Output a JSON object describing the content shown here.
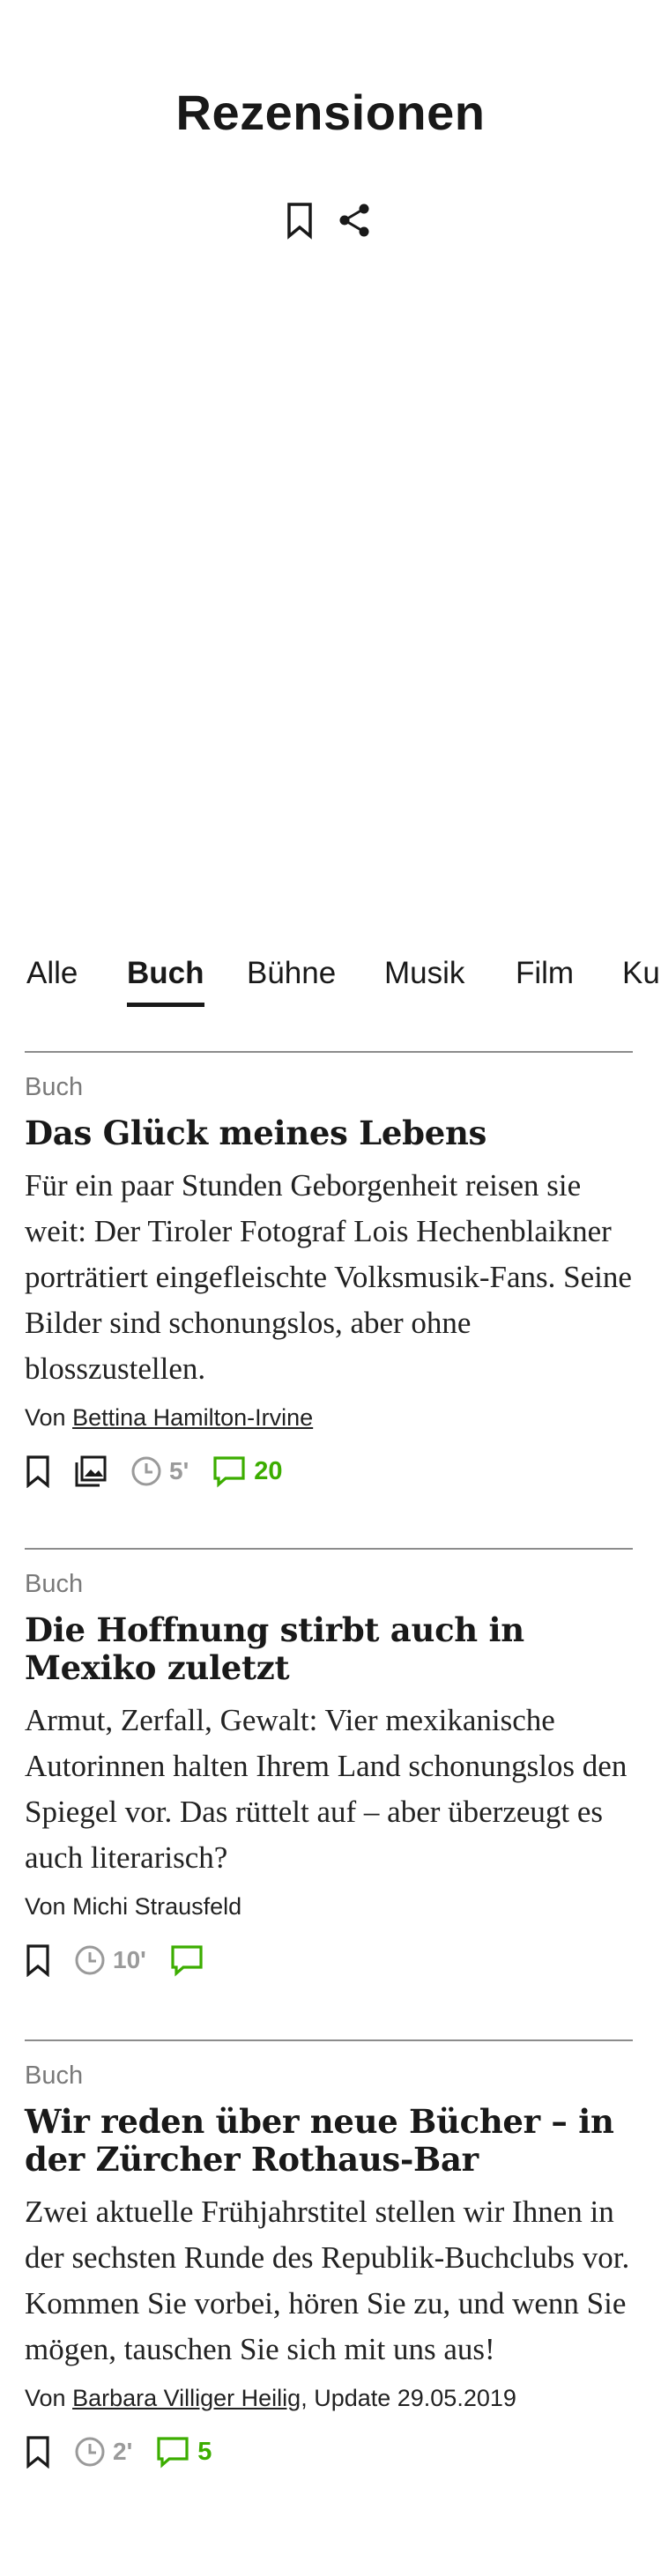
{
  "header": {
    "title": "Rezensionen"
  },
  "tabs": [
    {
      "label": "Alle"
    },
    {
      "label": "Buch"
    },
    {
      "label": "Bühne"
    },
    {
      "label": "Musik"
    },
    {
      "label": "Film"
    },
    {
      "label": "Ku"
    }
  ],
  "active_tab": "Buch",
  "articles": [
    {
      "category": "Buch",
      "title": "Das Glück meines Lebens",
      "lead": "Für ein paar Stunden Geborgenheit reisen sie weit: Der Tiroler Fotograf Lois Hechenblaikner porträtiert eingefleischte Volksmusik-Fans. Seine Bilder sind schonungslos, aber ohne blosszustellen.",
      "byline_prefix": "Von ",
      "author": "Bettina Hamilton-Irvine",
      "byline_suffix": "",
      "reading_time": "5'",
      "comments": "20"
    },
    {
      "category": "Buch",
      "title": "Die Hoffnung stirbt auch in Mexiko zuletzt",
      "lead": "Armut, Zerfall, Gewalt: Vier mexikanische Autorinnen halten Ihrem Land schonungslos den Spiegel vor. Das rüttelt auf – aber überzeugt es auch literarisch?",
      "byline_prefix": "Von ",
      "author": "Michi Strausfeld",
      "byline_suffix": "",
      "reading_time": "10'",
      "comments": ""
    },
    {
      "category": "Buch",
      "title": "Wir reden über neue Bücher – in der Zürcher Rothaus-Bar",
      "lead": "Zwei aktuelle Frühjahrstitel stellen wir Ihnen in der sechsten Runde des Republik-Buchclubs vor. Kommen Sie vorbei, hören Sie zu, und wenn Sie mögen, tauschen Sie sich mit uns aus!",
      "byline_prefix": "Von ",
      "author": "Barbara Villiger Heilig",
      "byline_suffix": ", Update 29.05.2019",
      "reading_time": "2'",
      "comments": "5"
    }
  ],
  "colors": {
    "text": "#191919",
    "muted": "#7a7a7a",
    "comment_accent": "#3cad00",
    "divider": "#8c8c8c"
  },
  "icons": {
    "header": [
      "bookmark-icon",
      "share-icon"
    ],
    "meta": [
      "bookmark-icon",
      "gallery-icon",
      "clock-icon",
      "comment-icon"
    ]
  }
}
